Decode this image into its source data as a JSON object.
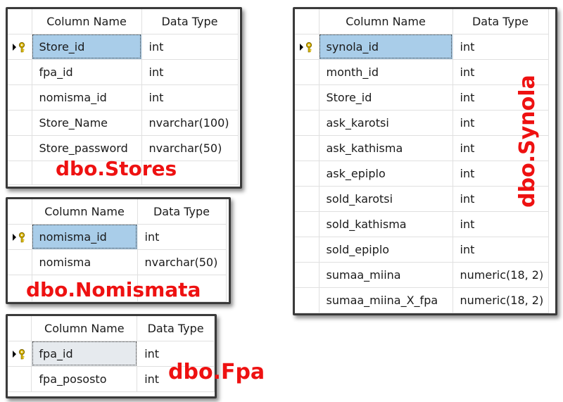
{
  "headers": {
    "column_name": "Column Name",
    "data_type": "Data Type"
  },
  "tables": {
    "stores": {
      "title": "dbo.Stores",
      "rows": [
        {
          "name": "Store_id",
          "type": "int"
        },
        {
          "name": "fpa_id",
          "type": "int"
        },
        {
          "name": "nomisma_id",
          "type": "int"
        },
        {
          "name": "Store_Name",
          "type": "nvarchar(100)"
        },
        {
          "name": "Store_password",
          "type": "nvarchar(50)"
        }
      ]
    },
    "nomismata": {
      "title": "dbo.Nomismata",
      "rows": [
        {
          "name": "nomisma_id",
          "type": "int"
        },
        {
          "name": "nomisma",
          "type": "nvarchar(50)"
        }
      ]
    },
    "fpa": {
      "title": "dbo.Fpa",
      "rows": [
        {
          "name": "fpa_id",
          "type": "int"
        },
        {
          "name": "fpa_pososto",
          "type": "int"
        }
      ]
    },
    "synola": {
      "title": "dbo.Synola",
      "rows": [
        {
          "name": "synola_id",
          "type": "int"
        },
        {
          "name": "month_id",
          "type": "int"
        },
        {
          "name": "Store_id",
          "type": "int"
        },
        {
          "name": "ask_karotsi",
          "type": "int"
        },
        {
          "name": "ask_kathisma",
          "type": "int"
        },
        {
          "name": "ask_epiplo",
          "type": "int"
        },
        {
          "name": "sold_karotsi",
          "type": "int"
        },
        {
          "name": "sold_kathisma",
          "type": "int"
        },
        {
          "name": "sold_epiplo",
          "type": "int"
        },
        {
          "name": "sumaa_miina",
          "type": "numeric(18, 2)"
        },
        {
          "name": "sumaa_miina_X_fpa",
          "type": "numeric(18, 2)"
        }
      ]
    }
  },
  "colors": {
    "title": "#ee1111",
    "selected_cell": "#a9cde9",
    "key_icon": "#d8b400"
  }
}
